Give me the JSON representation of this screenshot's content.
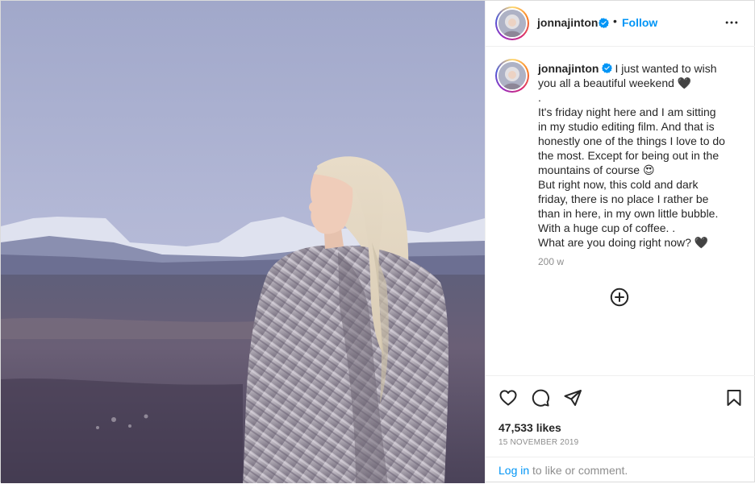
{
  "post": {
    "username": "jonnajinton",
    "follow_label": "Follow",
    "separator": "•",
    "caption_lines": [
      "I just wanted to wish",
      "you all a beautiful weekend 🖤",
      ".",
      "It's friday night here and I am sitting",
      "in my studio editing film. And that is",
      "honestly one of the things I love to do",
      "the most. Except for being out in the",
      "mountains of course 😍",
      "But right now, this cold and dark",
      "friday, there is no place I rather be",
      "than in here, in my own little bubble.",
      "With a huge cup of coffee. .",
      "What are you doing right now? 🖤"
    ],
    "caption_time": "200 w",
    "likes": "47,533 likes",
    "date": "15 NOVEMBER 2019",
    "login_link": "Log in",
    "login_rest": " to like or comment."
  },
  "icons": {
    "verified": "verified-badge-icon",
    "more": "more-options-icon",
    "load_more": "plus-circle-icon",
    "like": "heart-icon",
    "comment": "comment-icon",
    "share": "share-icon",
    "save": "bookmark-icon"
  },
  "colors": {
    "accent": "#0095f6",
    "verified": "#0095f6",
    "muted": "#8e8e8e",
    "text": "#262626"
  }
}
